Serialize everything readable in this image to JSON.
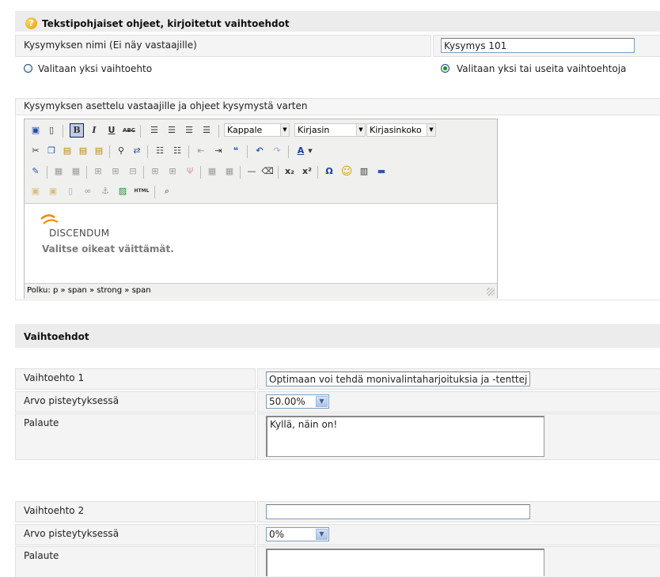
{
  "header": {
    "title": "Tekstipohjaiset ohjeet, kirjoitetut vaihtoehdot"
  },
  "question_name": {
    "label": "Kysymyksen nimi (Ei näy vastaajille)",
    "value": "Kysymys 101"
  },
  "choice_mode": {
    "single_label": "Valitaan yksi vaihtoehto",
    "multi_label": "Valitaan yksi tai useita vaihtoehtoja",
    "selected": "multi"
  },
  "instructions": {
    "label": "Kysymyksen asettelu vastaajille ja ohjeet kysymystä varten"
  },
  "editor": {
    "format_select": "Kappale",
    "font_select": "Kirjasin",
    "size_select": "Kirjasinkoko",
    "logo_text": "DISCENDUM",
    "content_text": "Valitse oikeat väittämät.",
    "path_label": "Polku: p » span » strong » span"
  },
  "options_section": {
    "title": "Vaihtoehdot"
  },
  "options": [
    {
      "label": "Vaihtoehto 1",
      "value": "Optimaan voi tehdä monivalintaharjoituksia ja -tenttejä.",
      "score_label": "Arvo pisteytyksessä",
      "score": "50.00%",
      "feedback_label": "Palaute",
      "feedback": "Kyllä, näin on!"
    },
    {
      "label": "Vaihtoehto 2",
      "value": "",
      "score_label": "Arvo pisteytyksessä",
      "score": "0%",
      "feedback_label": "Palaute",
      "feedback": ""
    }
  ]
}
